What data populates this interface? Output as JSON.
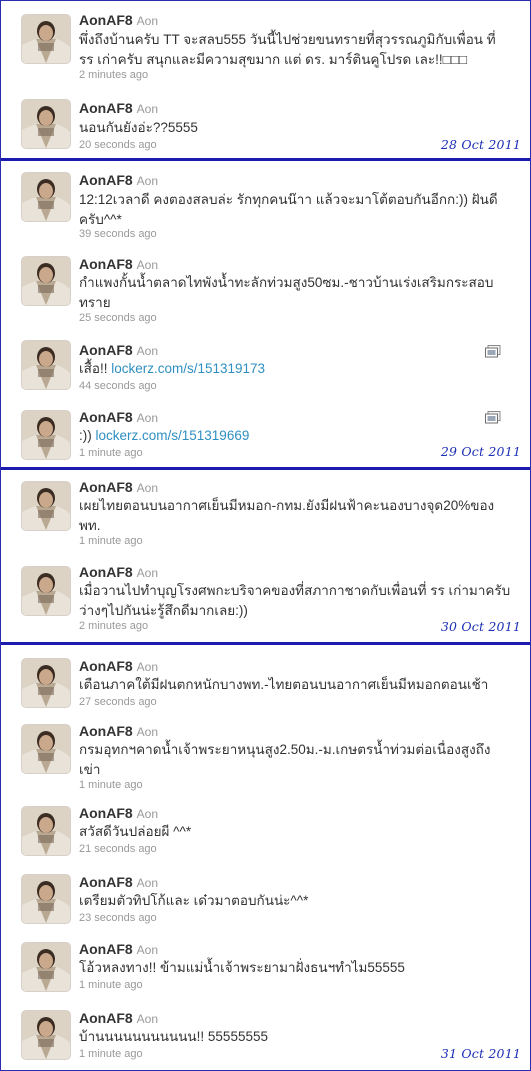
{
  "accent": "#1b1bb0",
  "link_color": "#2f8fc2",
  "groups": [
    {
      "date": "28 Oct 2011",
      "tweets": [
        {
          "username": "AonAF8",
          "fullname": "Aon",
          "text": "พึ่งถึงบ้านครับ TT จะสลบ555 วันนี้ไปช่วยขนทรายที่สุวรรณภูมิกับเพื่อน ที่ รร เก่าครับ สนุกและมีความสุขมาก แต่ ดร. มาร์ตินคูโปรด เละ!!□□□",
          "time": "2 minutes ago"
        },
        {
          "username": "AonAF8",
          "fullname": "Aon",
          "text": "นอนกันยังอ่ะ??5555",
          "time": "20 seconds ago"
        }
      ]
    },
    {
      "date": "29 Oct 2011",
      "tweets": [
        {
          "username": "AonAF8",
          "fullname": "Aon",
          "text": "12:12เวลาดี คงตองสลบล่ะ รักทุกคนน๊าา แล้วจะมาโต้ตอบกันอีกก:)) ฝันดีครับ^^*",
          "time": "39 seconds ago"
        },
        {
          "username": "AonAF8",
          "fullname": "Aon",
          "text": "กำแพงกั้นน้ำตลาดไทพังน้ำทะลักท่วมสูง50ซม.-ชาวบ้านเร่งเสริมกระสอบทราย",
          "time": "25 seconds ago"
        },
        {
          "username": "AonAF8",
          "fullname": "Aon",
          "text": "เสื้อ!! ",
          "link": "lockerz.com/s/151319173",
          "time": "44 seconds ago",
          "media_icon": "photo-icon"
        },
        {
          "username": "AonAF8",
          "fullname": "Aon",
          "text": ":)) ",
          "link": "lockerz.com/s/151319669",
          "time": "1 minute ago",
          "media_icon": "photo-icon"
        }
      ]
    },
    {
      "date": "30 Oct 2011",
      "tweets": [
        {
          "username": "AonAF8",
          "fullname": "Aon",
          "text": "เผยไทยตอนบนอากาศเย็นมีหมอก-กทม.ยังมีฝนฟ้าคะนองบางจุด20%ของพท.",
          "time": "1 minute ago"
        },
        {
          "username": "AonAF8",
          "fullname": "Aon",
          "text": "เมื่อวานไปทำบุญโรงศพกะบริจาคของที่สภากาชาดกับเพื่อนที่ รร เก่ามาครับ ว่างๆไปกันน่ะรู้สึกดีมากเลย:))",
          "time": "2 minutes ago"
        }
      ]
    },
    {
      "date": "31 Oct 2011",
      "tweets": [
        {
          "username": "AonAF8",
          "fullname": "Aon",
          "text": "เตือนภาคใต้มีฝนตกหนักบางพท.-ไทยตอนบนอากาศเย็นมีหมอกตอนเช้า",
          "time": "27 seconds ago"
        },
        {
          "username": "AonAF8",
          "fullname": "Aon",
          "text": "กรมอุทกฯคาดน้ำเจ้าพระยาหนุนสูง2.50ม.-ม.เกษตรน้ำท่วมต่อเนื่องสูงถึงเข่า",
          "time": "1 minute ago"
        },
        {
          "username": "AonAF8",
          "fullname": "Aon",
          "text": "สวัสดีวันปล่อยผี ^^*",
          "time": "21 seconds ago"
        },
        {
          "username": "AonAF8",
          "fullname": "Aon",
          "text": "เตรียมตัวทิปโก้และ เด๋วมาตอบกันน่ะ^^*",
          "time": "23 seconds ago"
        },
        {
          "username": "AonAF8",
          "fullname": "Aon",
          "text": "โอ้วหลงทาง!! ข้ามแม่น้ำเจ้าพระยามาฝั่งธนฯทำไม55555",
          "time": "1 minute ago"
        },
        {
          "username": "AonAF8",
          "fullname": "Aon",
          "text": "บ้านนนนนนนนนนน!! 55555555",
          "time": "1 minute ago"
        }
      ]
    }
  ]
}
